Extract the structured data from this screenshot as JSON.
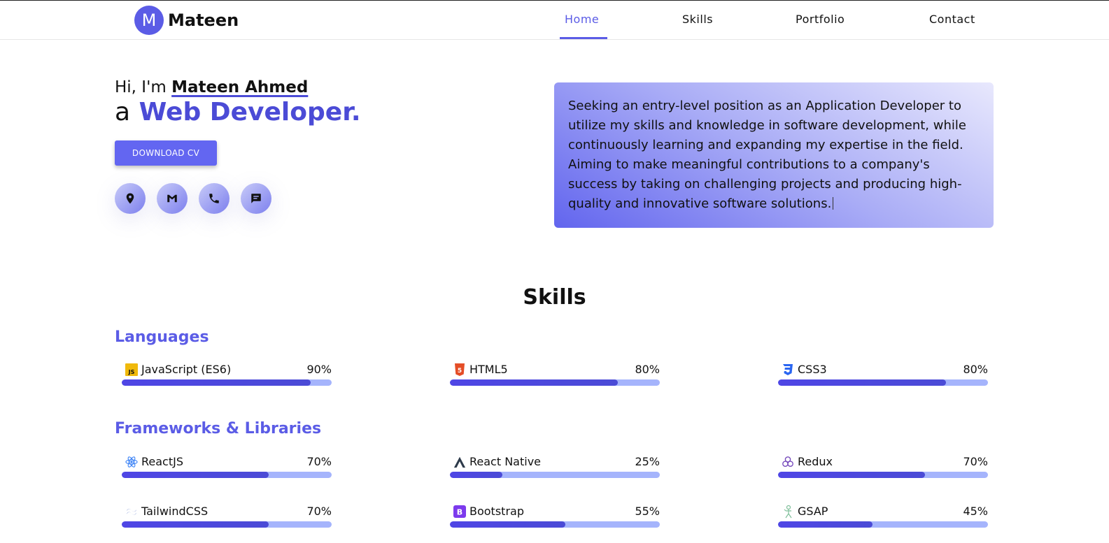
{
  "brand": {
    "mark": "M",
    "name": "Mateen"
  },
  "nav": {
    "items": [
      {
        "label": "Home",
        "active": true
      },
      {
        "label": "Skills",
        "active": false
      },
      {
        "label": "Portfolio",
        "active": false
      },
      {
        "label": "Contact",
        "active": false
      }
    ]
  },
  "hero": {
    "greeting_prefix": "Hi, I'm",
    "name": "Mateen Ahmed",
    "role_prefix": "a",
    "role": "Web Developer.",
    "cv_button": "DOWNLOAD CV",
    "socials": [
      {
        "icon": "location-pin-icon"
      },
      {
        "icon": "gmail-icon"
      },
      {
        "icon": "phone-icon"
      },
      {
        "icon": "chat-icon"
      }
    ]
  },
  "about": {
    "text": "Seeking an entry-level position as an Application Developer to utilize my skills and knowledge in software development, while continuously learning and expanding my expertise in the field. Aiming to make meaningful contributions to a company's success by taking on challenging projects and producing high-quality and innovative software solutions."
  },
  "skills": {
    "title": "Skills",
    "groups": [
      {
        "title": "Languages",
        "items": [
          {
            "name": "JavaScript (ES6)",
            "percent": 90,
            "percent_label": "90%",
            "icon": "javascript-icon"
          },
          {
            "name": "HTML5",
            "percent": 80,
            "percent_label": "80%",
            "icon": "html5-icon"
          },
          {
            "name": "CSS3",
            "percent": 80,
            "percent_label": "80%",
            "icon": "css3-icon"
          }
        ]
      },
      {
        "title": "Frameworks & Libraries",
        "items": [
          {
            "name": "ReactJS",
            "percent": 70,
            "percent_label": "70%",
            "icon": "react-icon"
          },
          {
            "name": "React Native",
            "percent": 25,
            "percent_label": "25%",
            "icon": "react-native-icon"
          },
          {
            "name": "Redux",
            "percent": 70,
            "percent_label": "70%",
            "icon": "redux-icon"
          },
          {
            "name": "TailwindCSS",
            "percent": 70,
            "percent_label": "70%",
            "icon": "tailwindcss-icon"
          },
          {
            "name": "Bootstrap",
            "percent": 55,
            "percent_label": "55%",
            "icon": "bootstrap-icon"
          },
          {
            "name": "GSAP",
            "percent": 45,
            "percent_label": "45%",
            "icon": "gsap-icon"
          }
        ]
      }
    ]
  },
  "colors": {
    "accent": "#5b5ce6",
    "accent_dark": "#4b4bd6",
    "track": "#a5b4fc"
  }
}
